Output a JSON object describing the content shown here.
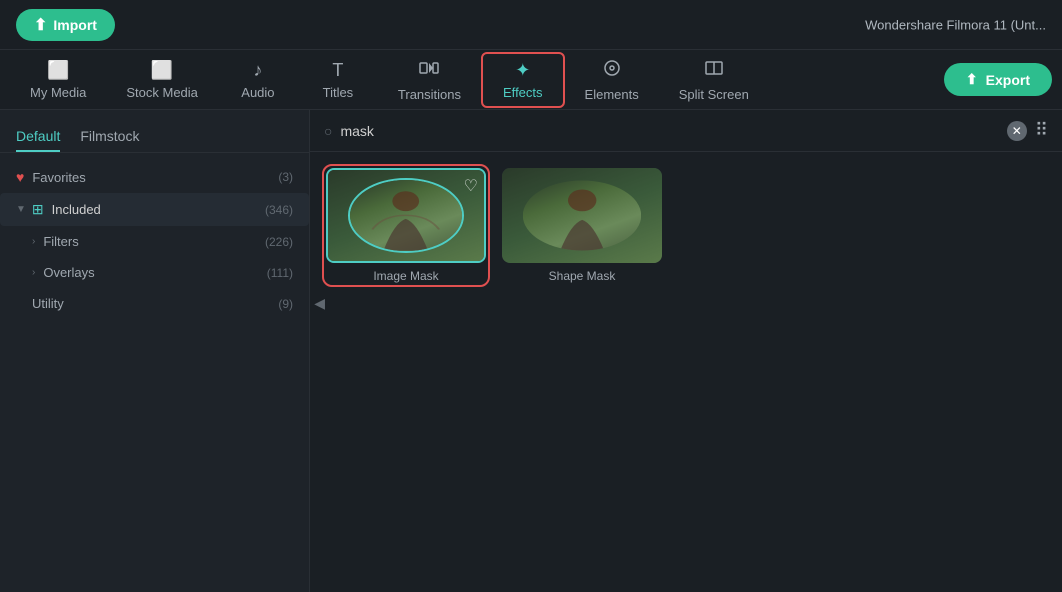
{
  "app": {
    "title": "Wondershare Filmora 11 (Unt...",
    "import_label": "Import",
    "export_label": "Export"
  },
  "nav": {
    "tabs": [
      {
        "id": "my-media",
        "label": "My Media",
        "icon": "🖼"
      },
      {
        "id": "stock-media",
        "label": "Stock Media",
        "icon": "🖼"
      },
      {
        "id": "audio",
        "label": "Audio",
        "icon": "🎵"
      },
      {
        "id": "titles",
        "label": "Titles",
        "icon": "T"
      },
      {
        "id": "transitions",
        "label": "Transitions",
        "icon": "⊳|"
      },
      {
        "id": "effects",
        "label": "Effects",
        "icon": "✦",
        "active": true
      },
      {
        "id": "elements",
        "label": "Elements",
        "icon": "☺"
      },
      {
        "id": "split-screen",
        "label": "Split Screen",
        "icon": "⊟"
      }
    ]
  },
  "sidebar": {
    "tabs": [
      {
        "id": "default",
        "label": "Default",
        "active": true
      },
      {
        "id": "filmstock",
        "label": "Filmstock"
      }
    ],
    "items": [
      {
        "id": "favorites",
        "label": "Favorites",
        "count": "(3)",
        "icon": "heart",
        "indent": 0
      },
      {
        "id": "included",
        "label": "Included",
        "count": "(346)",
        "icon": "grid",
        "indent": 0,
        "expanded": true,
        "active": true
      },
      {
        "id": "filters",
        "label": "Filters",
        "count": "(226)",
        "indent": 1
      },
      {
        "id": "overlays",
        "label": "Overlays",
        "count": "(111)",
        "indent": 1
      },
      {
        "id": "utility",
        "label": "Utility",
        "count": "(9)",
        "indent": 1
      }
    ]
  },
  "search": {
    "placeholder": "mask",
    "value": "mask",
    "clear_title": "clear"
  },
  "effects": {
    "items": [
      {
        "id": "image-mask",
        "label": "Image Mask",
        "selected": true
      },
      {
        "id": "shape-mask",
        "label": "Shape Mask",
        "selected": false
      }
    ]
  }
}
